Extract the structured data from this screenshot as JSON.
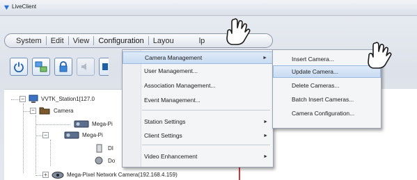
{
  "window": {
    "title": "LiveClient"
  },
  "menubar": {
    "items": [
      "System",
      "Edit",
      "View",
      "Configuration",
      "Layout",
      "Help"
    ],
    "visible_text": [
      "System",
      "Edit",
      "View",
      "Configuration",
      "Layou",
      "lp"
    ]
  },
  "toolbar": {
    "buttons": [
      "power-icon",
      "network-icon",
      "lock-icon",
      "speaker-icon",
      "blue-square-icon"
    ]
  },
  "tree": {
    "root": "VVTK_Station1[127.0",
    "camera_group": "Camera",
    "children": [
      "Mega-Pi",
      "Mega-Pi",
      "DI",
      "Do",
      "Mega-Pixel Network Camera(192.168.4.159)"
    ]
  },
  "config_menu": {
    "items": [
      {
        "label": "Camera Management",
        "arrow": "►"
      },
      {
        "label": "User Management...",
        "arrow": ""
      },
      {
        "label": "Association Management...",
        "arrow": ""
      },
      {
        "label": "Event Management...",
        "arrow": ""
      },
      {
        "label": "Station Settings",
        "arrow": "►"
      },
      {
        "label": "Client Settings",
        "arrow": "►"
      },
      {
        "label": "Video Enhancement",
        "arrow": "►"
      }
    ]
  },
  "camera_submenu": {
    "items": [
      "Insert Camera...",
      "Update Camera...",
      "Delete Cameras...",
      "Batch Insert Cameras...",
      "Camera Configuration..."
    ]
  },
  "colors": {
    "highlight": "#c9dcf3",
    "red_line": "#dd3333",
    "menu_border": "#8b95a5"
  }
}
